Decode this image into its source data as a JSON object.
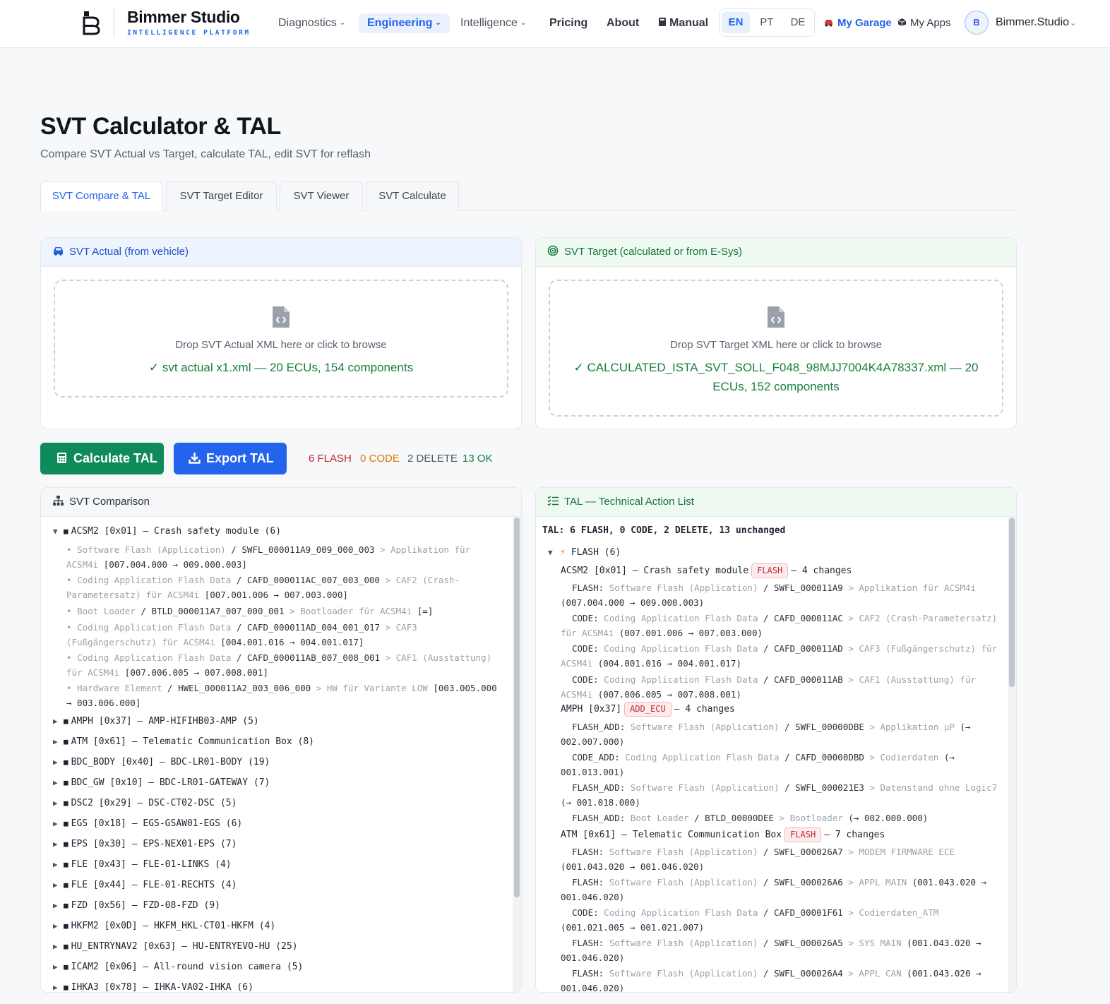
{
  "header": {
    "brand_name": "Bimmer Studio",
    "brand_tagline": "INTELLIGENCE PLATFORM",
    "nav": {
      "diagnostics": "Diagnostics",
      "engineering": "Engineering",
      "intelligence": "Intelligence",
      "pricing": "Pricing",
      "about": "About",
      "manual": "Manual"
    },
    "languages": [
      "EN",
      "PT",
      "DE"
    ],
    "my_garage": "My Garage",
    "my_apps": "My Apps",
    "avatar_initial": "B",
    "user_name": "Bimmer.Studio"
  },
  "page": {
    "title": "SVT Calculator & TAL",
    "subtitle": "Compare SVT Actual vs Target, calculate TAL, edit SVT for reflash"
  },
  "tabs": [
    "SVT Compare & TAL",
    "SVT Target Editor",
    "SVT Viewer",
    "SVT Calculate"
  ],
  "actual_card": {
    "title": "SVT Actual (from vehicle)",
    "hint": "Drop SVT Actual XML here or click to browse",
    "loaded": "✓ svt actual x1.xml — 20 ECUs, 154 components"
  },
  "target_card": {
    "title": "SVT Target (calculated or from E-Sys)",
    "hint": "Drop SVT Target XML here or click to browse",
    "loaded": "✓ CALCULATED_ISTA_SVT_SOLL_F048_98MJJ7004K4A78337.xml — 20 ECUs, 152 components"
  },
  "actions": {
    "calculate": "Calculate TAL",
    "export": "Export TAL"
  },
  "stats": {
    "flash": "6 FLASH",
    "code": "0 CODE",
    "delete": "2 DELETE",
    "ok": "13 OK"
  },
  "colors": {
    "accent": "#2463eb",
    "green_button": "#0f8a5a",
    "flash": "#c0262d",
    "code": "#d97706",
    "delete": "#4b5563",
    "ok": "#15803d"
  },
  "comparison": {
    "title": "SVT Comparison",
    "expanded": {
      "label": "ACSM2 [0x01] — Crash safety module (6)",
      "components": [
        {
          "type": "Software Flash (Application)",
          "id": "SWFL_000011A9_009_000_003",
          "desc": "Applikation für ACSM4i",
          "version": "[007.004.000 → 009.000.003]"
        },
        {
          "type": "Coding Application Flash Data",
          "id": "CAFD_000011AC_007_003_000",
          "desc": "CAF2 (Crash-Parametersatz) für ACSM4i",
          "version": "[007.001.006 → 007.003.000]"
        },
        {
          "type": "Boot Loader",
          "id": "BTLD_000011A7_007_000_001",
          "desc": "Bootloader für ACSM4i",
          "version": "[=]"
        },
        {
          "type": "Coding Application Flash Data",
          "id": "CAFD_000011AD_004_001_017",
          "desc": "CAF3 (Fußgängerschutz) für ACSM4i",
          "version": "[004.001.016 → 004.001.017]"
        },
        {
          "type": "Coding Application Flash Data",
          "id": "CAFD_000011AB_007_008_001",
          "desc": "CAF1 (Ausstattung) für ACSM4i",
          "version": "[007.006.005 → 007.008.001]"
        },
        {
          "type": "Hardware Element",
          "id": "HWEL_000011A2_003_006_000",
          "desc": "HW für Variante LOW",
          "version": "[003.005.000 → 003.006.000]"
        }
      ]
    },
    "collapsed": [
      "AMPH [0x37] — AMP-HIFIHB03-AMP (5)",
      "ATM [0x61] — Telematic Communication Box (8)",
      "BDC_BODY [0x40] — BDC-LR01-BODY (19)",
      "BDC_GW [0x10] — BDC-LR01-GATEWAY (7)",
      "DSC2 [0x29] — DSC-CT02-DSC (5)",
      "EGS [0x18] — EGS-GSAW01-EGS (6)",
      "EPS [0x30] — EPS-NEX01-EPS (7)",
      "FLE [0x43] — FLE-01-LINKS (4)",
      "FLE [0x44] — FLE-01-RECHTS (4)",
      "FZD [0x56] — FZD-08-FZD (9)",
      "HKFM2 [0x0D] — HKFM_HKL-CT01-HKFM (4)",
      "HU_ENTRYNAV2 [0x63] — HU-ENTRYEVO-HU (25)",
      "ICAM2 [0x06] — All-round vision camera (5)",
      "IHKA3 [0x78] — IHKA-VA02-IHKA (6)"
    ]
  },
  "tal": {
    "title": "TAL — Technical Action List",
    "summary": "TAL: 6 FLASH, 0 CODE, 2 DELETE, 13 unchanged",
    "group_label": "FLASH (6)",
    "ecus": [
      {
        "name": "ACSM2 [0x01] — Crash safety module",
        "badge": "FLASH",
        "changes": "— 4 changes",
        "lines": [
          {
            "action": "FLASH:",
            "type": "Software Flash (Application)",
            "id": "SWFL_000011A9",
            "desc": "Applikation für ACSM4i",
            "version": "(007.004.000 → 009.000.003)"
          },
          {
            "action": "CODE:",
            "type": "Coding Application Flash Data",
            "id": "CAFD_000011AC",
            "desc": "CAF2 (Crash-Parametersatz) für ACSM4i",
            "version": "(007.001.006 → 007.003.000)"
          },
          {
            "action": "CODE:",
            "type": "Coding Application Flash Data",
            "id": "CAFD_000011AD",
            "desc": "CAF3 (Fußgängerschutz) für ACSM4i",
            "version": "(004.001.016 → 004.001.017)"
          },
          {
            "action": "CODE:",
            "type": "Coding Application Flash Data",
            "id": "CAFD_000011AB",
            "desc": "CAF1 (Ausstattung) für ACSM4i",
            "version": "(007.006.005 → 007.008.001)"
          }
        ]
      },
      {
        "name": "AMPH [0x37]",
        "badge": "ADD_ECU",
        "changes": "— 4 changes",
        "lines": [
          {
            "action": "FLASH_ADD:",
            "type": "Software Flash (Application)",
            "id": "SWFL_00000DBE",
            "desc": "Applikation µP",
            "version": "(→ 002.007.000)"
          },
          {
            "action": "CODE_ADD:",
            "type": "Coding Application Flash Data",
            "id": "CAFD_00000DBD",
            "desc": "Codierdaten",
            "version": "(→ 001.013.001)"
          },
          {
            "action": "FLASH_ADD:",
            "type": "Software Flash (Application)",
            "id": "SWFL_000021E3",
            "desc": "Datenstand ohne Logic7",
            "version": "(→ 001.018.000)"
          },
          {
            "action": "FLASH_ADD:",
            "type": "Boot Loader",
            "id": "BTLD_00000DEE",
            "desc": "Bootloader",
            "version": "(→ 002.000.000)"
          }
        ]
      },
      {
        "name": "ATM [0x61] — Telematic Communication Box",
        "badge": "FLASH",
        "changes": "— 7 changes",
        "lines": [
          {
            "action": "FLASH:",
            "type": "Software Flash (Application)",
            "id": "SWFL_000026A7",
            "desc": "MODEM FIRMWARE ECE",
            "version": "(001.043.020 → 001.046.020)"
          },
          {
            "action": "FLASH:",
            "type": "Software Flash (Application)",
            "id": "SWFL_000026A6",
            "desc": "APPL MAIN",
            "version": "(001.043.020 → 001.046.020)"
          },
          {
            "action": "CODE:",
            "type": "Coding Application Flash Data",
            "id": "CAFD_00001F61",
            "desc": "Codierdaten_ATM",
            "version": "(001.021.005 → 001.021.007)"
          },
          {
            "action": "FLASH:",
            "type": "Software Flash (Application)",
            "id": "SWFL_000026A5",
            "desc": "SYS MAIN",
            "version": "(001.043.020 → 001.046.020)"
          },
          {
            "action": "FLASH:",
            "type": "Software Flash (Application)",
            "id": "SWFL_000026A4",
            "desc": "APPL CAN",
            "version": "(001.043.020 → 001.046.020)"
          }
        ]
      }
    ]
  }
}
